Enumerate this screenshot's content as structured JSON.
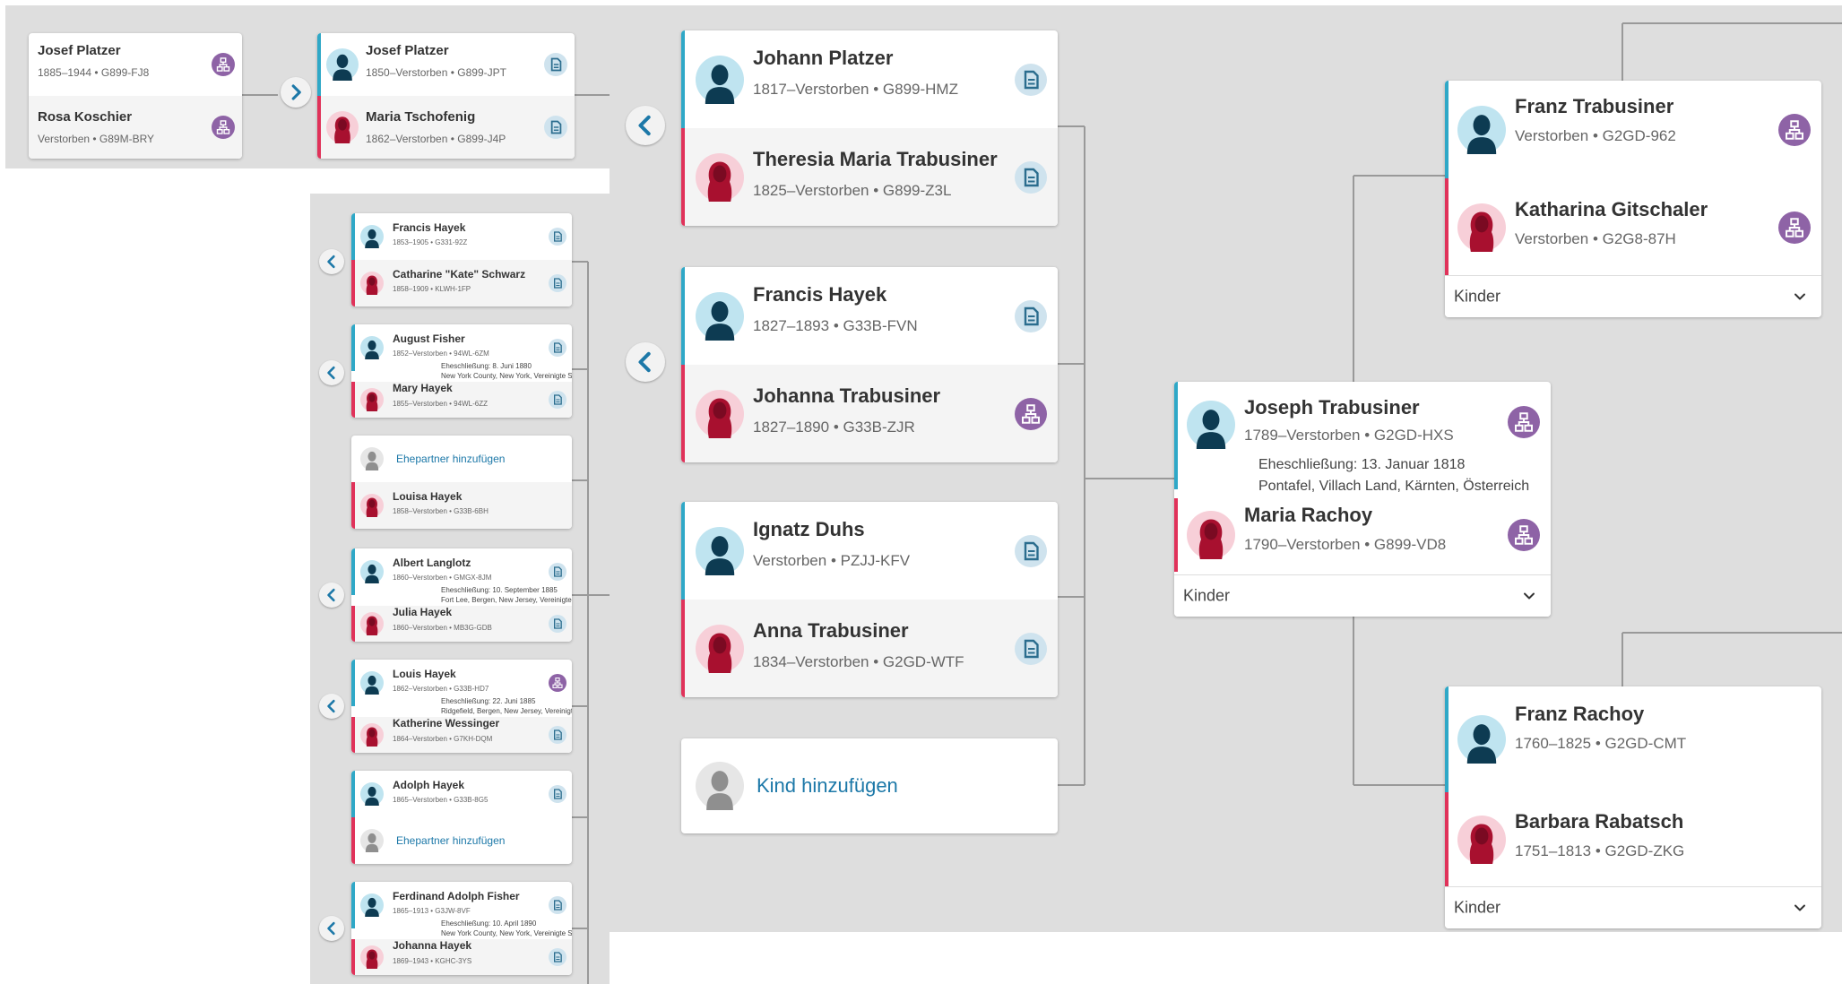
{
  "icons": {
    "male": "male-avatar-icon",
    "female": "female-avatar-icon",
    "unknown": "unknown-avatar-icon",
    "record": "record-hint-icon",
    "tree": "tree-hint-icon",
    "back": "chevron-left-icon",
    "forward": "chevron-right-icon",
    "expand": "chevron-down-icon"
  },
  "colors": {
    "male_bar": "#2fa8c7",
    "female_bar": "#e0325a",
    "link": "#1c78a8",
    "record_hint": "#cfe3ee",
    "tree_hint": "#8e63a6",
    "background": "#dedede"
  },
  "labels": {
    "kinder": "Kinder",
    "add_spouse": "Ehepartner hinzufügen",
    "add_child": "Kind hinzufügen"
  },
  "panel_a": {
    "couple1": {
      "husband": {
        "name": "Josef Platzer",
        "meta": "1885–1944 • G899-FJ8"
      },
      "wife": {
        "name": "Rosa Koschier",
        "meta": "Verstorben • G89M-BRY"
      }
    },
    "couple2": {
      "husband": {
        "name": "Josef Platzer",
        "meta": "1850–Verstorben • G899-JPT"
      },
      "wife": {
        "name": "Maria Tschofenig",
        "meta": "1862–Verstorben • G899-J4P"
      }
    }
  },
  "panel_b": {
    "families": [
      {
        "husband": {
          "name": "Francis Hayek",
          "meta": "1853–1905 • G331-92Z"
        },
        "wife": {
          "name": "Catharine \"Kate\" Schwarz",
          "meta": "1858–1909 • KLWH-1FP"
        }
      },
      {
        "husband": {
          "name": "August Fisher",
          "meta": "1852–Verstorben • 94WL-6ZM"
        },
        "marriage": "Eheschließung: 8. Juni 1880",
        "place": "New York County, New York, Vereinigte St...",
        "wife": {
          "name": "Mary Hayek",
          "meta": "1855–Verstorben • 94WL-6ZZ"
        }
      },
      {
        "wife": {
          "name": "Louisa Hayek",
          "meta": "1858–Verstorben • G33B-6BH"
        }
      },
      {
        "husband": {
          "name": "Albert Langlotz",
          "meta": "1860–Verstorben • GMGX-8JM"
        },
        "marriage": "Eheschließung: 10. September 1885",
        "place": "Fort Lee, Bergen, New Jersey, Vereinigte St...",
        "wife": {
          "name": "Julia Hayek",
          "meta": "1860–Verstorben • MB3G-GDB"
        }
      },
      {
        "husband": {
          "name": "Louis Hayek",
          "meta": "1862–Verstorben • G33B-HD7"
        },
        "marriage": "Eheschließung: 22. Juni 1885",
        "place": "Ridgefield, Bergen, New Jersey, Vereinigte ...",
        "wife": {
          "name": "Katherine Wessinger",
          "meta": "1864–Verstorben • G7KH-DQM"
        }
      },
      {
        "husband": {
          "name": "Adolph Hayek",
          "meta": "1865–Verstorben • G33B-8G5"
        }
      },
      {
        "husband": {
          "name": "Ferdinand Adolph Fisher",
          "meta": "1865–1913 • G3JW-8VF"
        },
        "marriage": "Eheschließung: 10. April 1890",
        "place": "New York County, New York, Vereinigte St...",
        "wife": {
          "name": "Johanna Hayek",
          "meta": "1869–1943 • KGHC-3YS"
        }
      }
    ]
  },
  "panel_c": {
    "children": [
      {
        "husband": {
          "name": "Johann Platzer",
          "meta": "1817–Verstorben • G899-HMZ"
        },
        "wife": {
          "name": "Theresia Maria Trabusiner",
          "meta": "1825–Verstorben • G899-Z3L"
        }
      },
      {
        "husband": {
          "name": "Francis Hayek",
          "meta": "1827–1893 • G33B-FVN"
        },
        "wife": {
          "name": "Johanna Trabusiner",
          "meta": "1827–1890 • G33B-ZJR"
        }
      },
      {
        "husband": {
          "name": "Ignatz Duhs",
          "meta": "Verstorben • PZJJ-KFV"
        },
        "wife": {
          "name": "Anna Trabusiner",
          "meta": "1834–Verstorben • G2GD-WTF"
        }
      }
    ],
    "focus": {
      "husband": {
        "name": "Joseph Trabusiner",
        "meta": "1789–Verstorben • G2GD-HXS"
      },
      "marriage": "Eheschließung: 13. Januar 1818",
      "place": "Pontafel, Villach Land, Kärnten, Österreich",
      "wife": {
        "name": "Maria Rachoy",
        "meta": "1790–Verstorben • G899-VD8"
      }
    },
    "parents_husband": {
      "husband": {
        "name": "Franz Trabusiner",
        "meta": "Verstorben • G2GD-962"
      },
      "wife": {
        "name": "Katharina Gitschaler",
        "meta": "Verstorben • G2G8-87H"
      }
    },
    "parents_wife": {
      "husband": {
        "name": "Franz Rachoy",
        "meta": "1760–1825 • G2GD-CMT"
      },
      "wife": {
        "name": "Barbara Rabatsch",
        "meta": "1751–1813 • G2GD-ZKG"
      }
    }
  }
}
